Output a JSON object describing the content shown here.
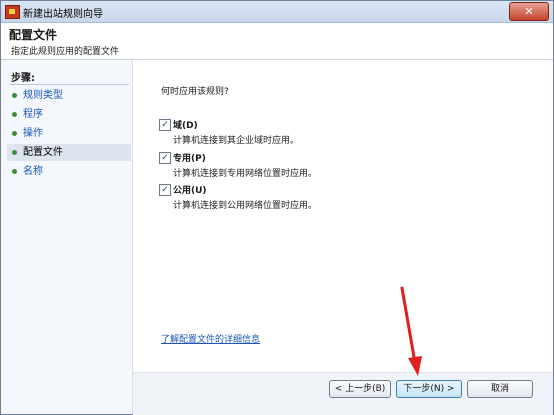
{
  "window": {
    "title": "新建出站规则向导",
    "close_glyph": "✕"
  },
  "header": {
    "title": "配置文件",
    "subtitle": "指定此规则应用的配置文件"
  },
  "steps": {
    "title": "步骤:",
    "items": [
      {
        "label": "规则类型",
        "state": "link"
      },
      {
        "label": "程序",
        "state": "link"
      },
      {
        "label": "操作",
        "state": "link"
      },
      {
        "label": "配置文件",
        "state": "current"
      },
      {
        "label": "名称",
        "state": "link"
      }
    ]
  },
  "content": {
    "question": "何时应用该规则?",
    "options": [
      {
        "label": "域(D)",
        "description": "计算机连接到其企业域时应用。",
        "checked": true
      },
      {
        "label": "专用(P)",
        "description": "计算机连接到专用网络位置时应用。",
        "checked": true
      },
      {
        "label": "公用(U)",
        "description": "计算机连接到公用网络位置时应用。",
        "checked": true
      }
    ],
    "help_link": "了解配置文件的详细信息",
    "check_glyph": "✓"
  },
  "footer": {
    "back_label": "< 上一步(B)",
    "next_label": "下一步(N) >",
    "cancel_label": "取消"
  },
  "colors": {
    "link": "#1a56b8",
    "step_bullet": "#3a8f3a",
    "annotation_arrow": "#e31e1e"
  },
  "icons": {
    "title_icon": "firewall-icon",
    "close": "close-icon",
    "step_bullet": "green-bullet-icon",
    "annotation": "red-arrow-icon"
  }
}
